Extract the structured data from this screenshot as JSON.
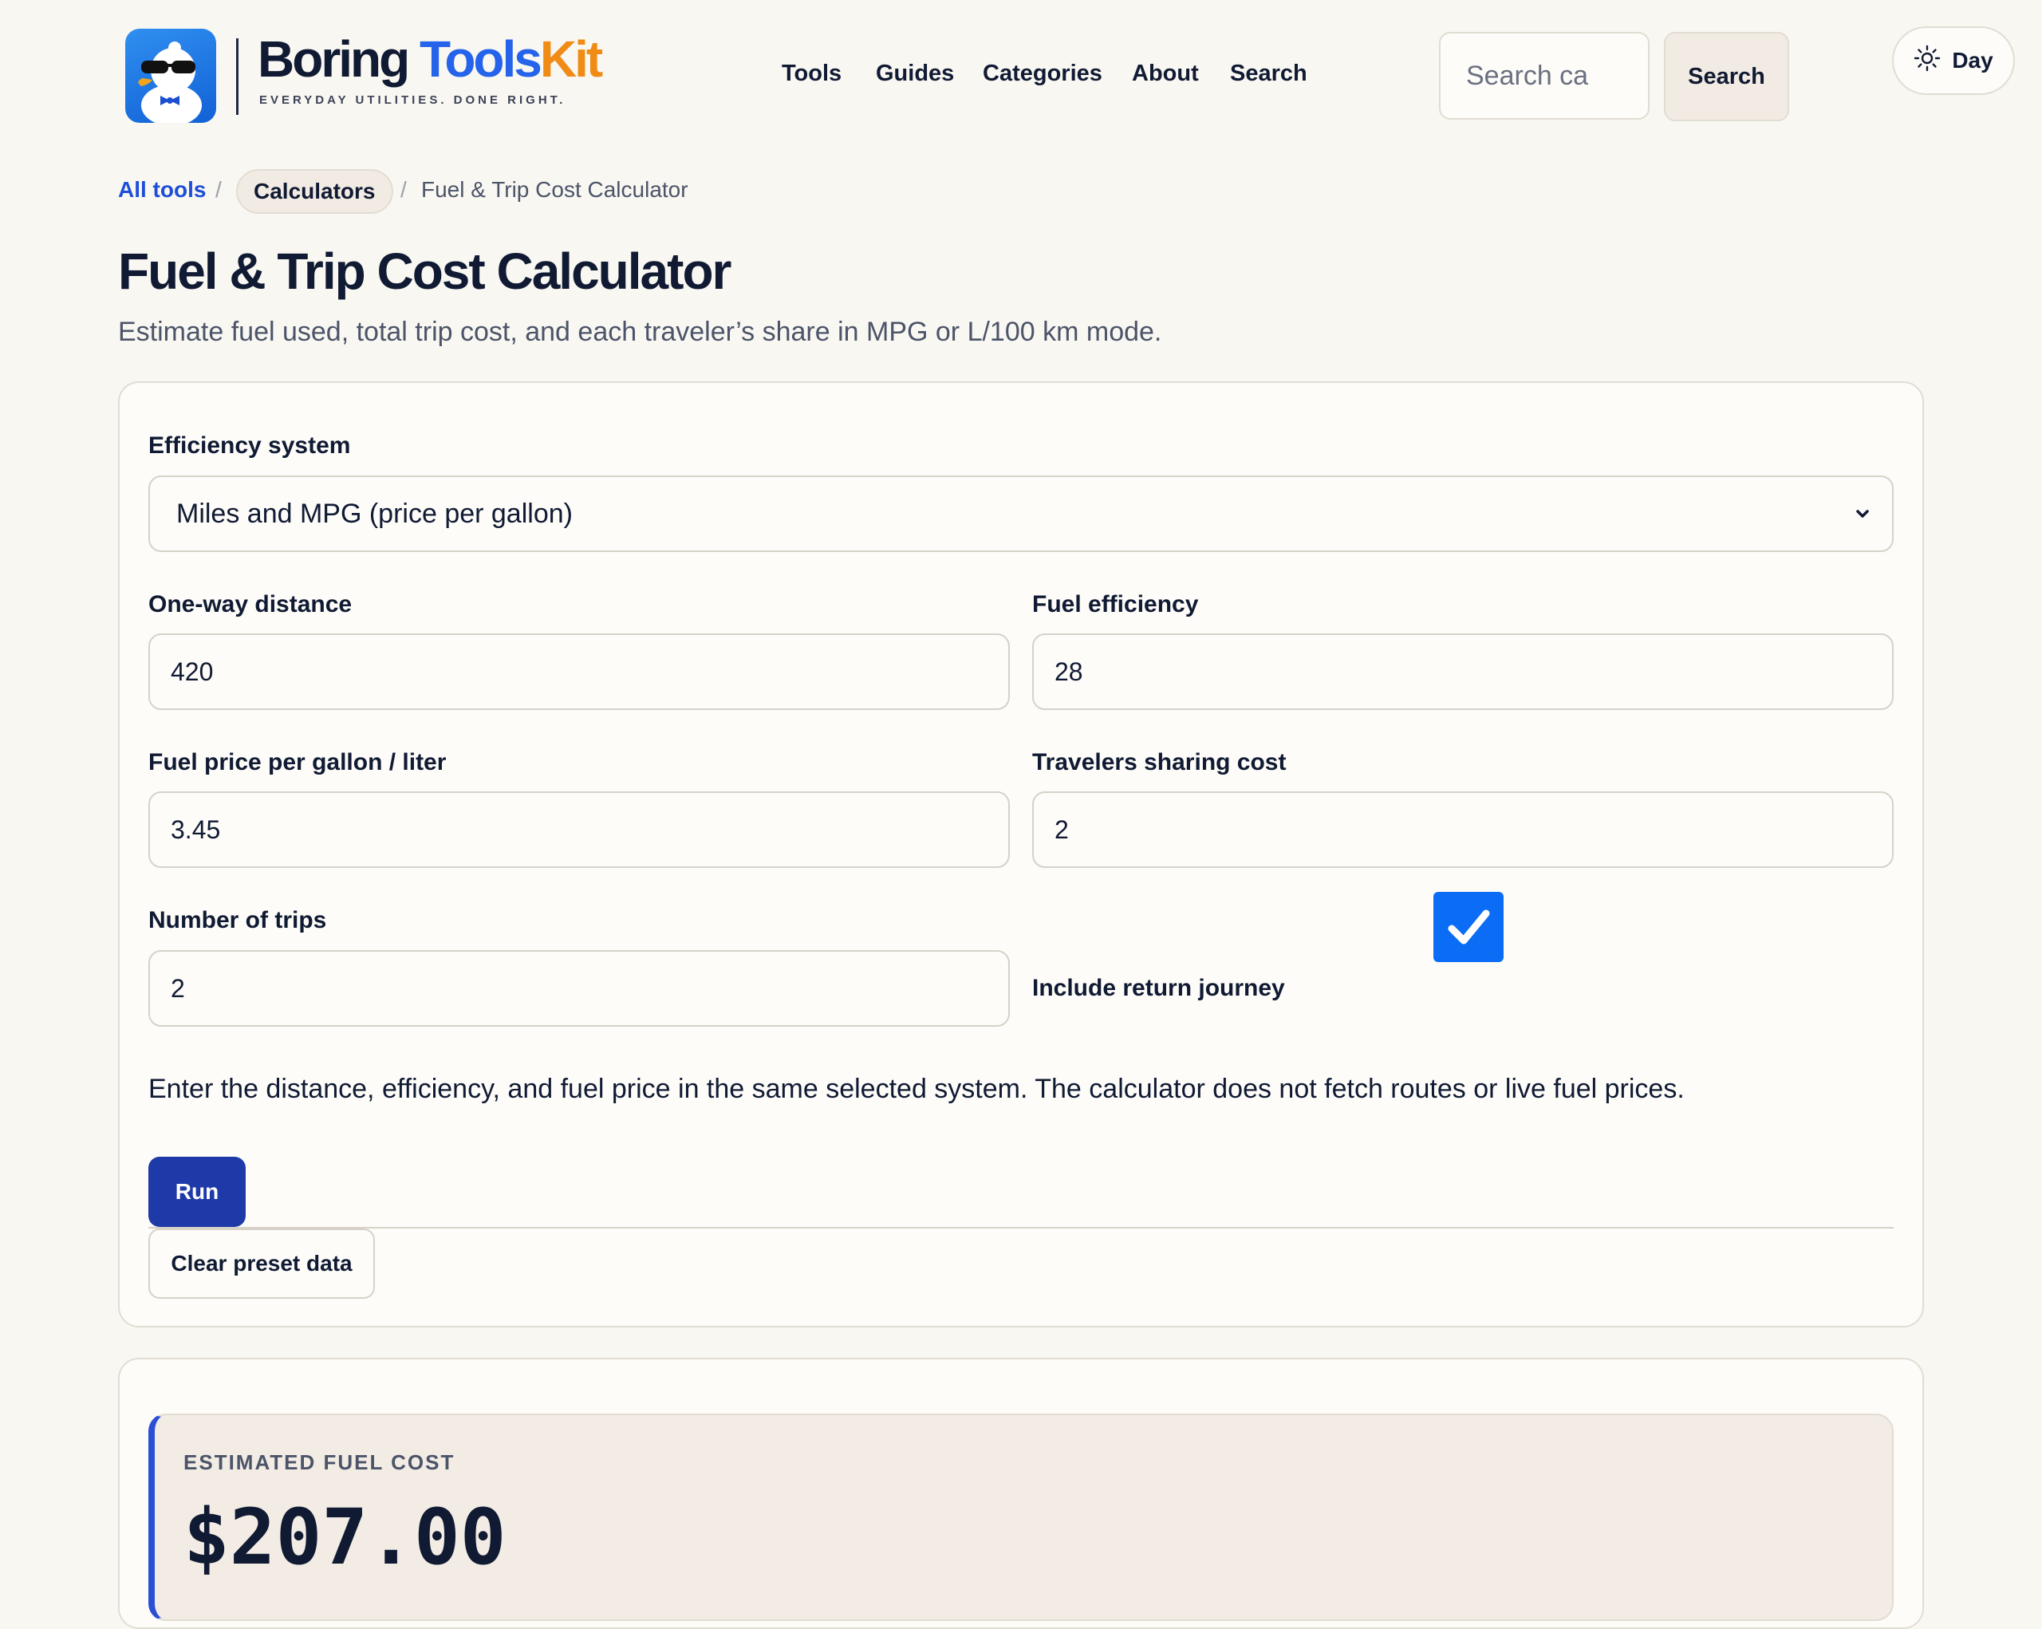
{
  "brand": {
    "name_part1": "Boring ",
    "name_part2": "Tools",
    "name_part3": "Kit",
    "tagline": "EVERYDAY UTILITIES. DONE RIGHT.",
    "logo_icon": "duck-with-sunglasses-icon"
  },
  "nav": {
    "items": [
      {
        "label": "Tools"
      },
      {
        "label": "Guides"
      },
      {
        "label": "Categories"
      },
      {
        "label": "About"
      },
      {
        "label": "Search"
      }
    ]
  },
  "search": {
    "placeholder": "Search ca",
    "button_label": "Search"
  },
  "theme_toggle": {
    "label": "Day",
    "icon": "sun-icon"
  },
  "breadcrumb": {
    "root": "All tools",
    "separator": "/",
    "category": "Calculators",
    "current": "Fuel & Trip Cost Calculator"
  },
  "page": {
    "title": "Fuel & Trip Cost Calculator",
    "subtitle": "Estimate fuel used, total trip cost, and each traveler’s share in MPG or L/100 km mode."
  },
  "form": {
    "efficiency_system": {
      "label": "Efficiency system",
      "selected": "Miles and MPG (price per gallon)"
    },
    "distance": {
      "label": "One-way distance",
      "value": "420"
    },
    "efficiency": {
      "label": "Fuel efficiency",
      "value": "28"
    },
    "price": {
      "label": "Fuel price per gallon / liter",
      "value": "3.45"
    },
    "travelers": {
      "label": "Travelers sharing cost",
      "value": "2"
    },
    "trips": {
      "label": "Number of trips",
      "value": "2"
    },
    "return_journey": {
      "label": "Include return journey",
      "checked": true
    },
    "help_text": "Enter the distance, efficiency, and fuel price in the same selected system. The calculator does not fetch routes or live fuel prices.",
    "run_label": "Run",
    "clear_label": "Clear preset data"
  },
  "result": {
    "label": "ESTIMATED FUEL COST",
    "value": "$207.00"
  },
  "colors": {
    "accent": "#1e3aa8",
    "link": "#1d4ed8",
    "brand_blue": "#2563eb",
    "brand_orange": "#f08c16",
    "checkbox": "#0b6cf5",
    "background": "#f9f7f2"
  }
}
